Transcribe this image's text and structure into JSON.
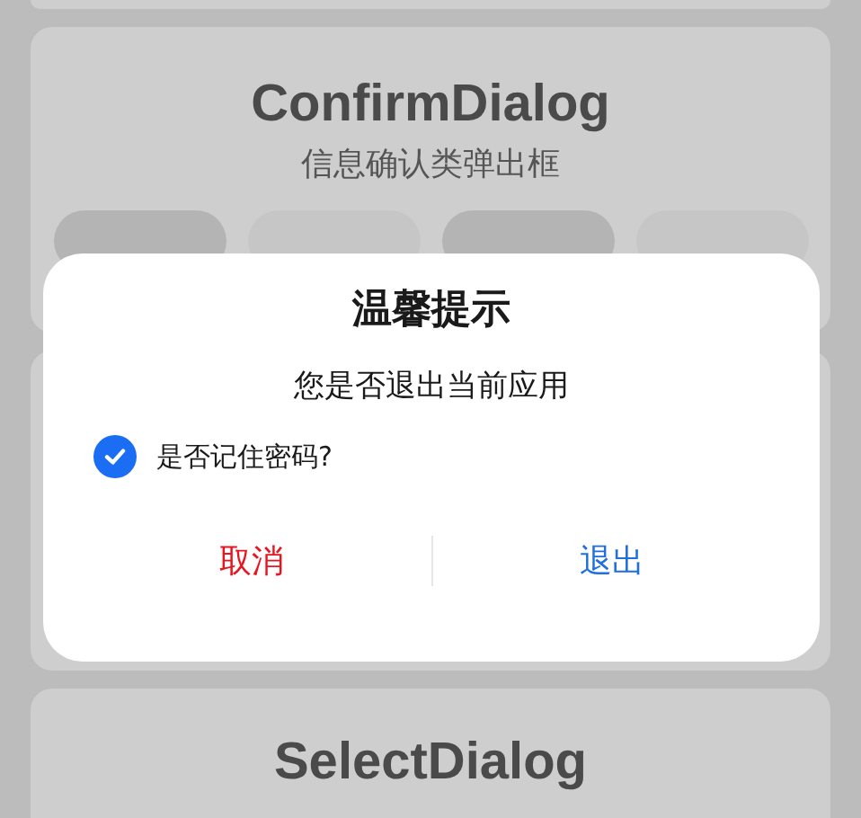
{
  "page": {
    "cards": [
      {
        "title": "ConfirmDialog",
        "subtitle": "信息确认类弹出框"
      },
      {
        "title": "SelectDialog"
      }
    ]
  },
  "dialog": {
    "title": "温馨提示",
    "message": "您是否退出当前应用",
    "checkbox": {
      "label": "是否记住密码?",
      "checked": true
    },
    "buttons": [
      {
        "label": "取消",
        "kind": "cancel"
      },
      {
        "label": "退出",
        "kind": "confirm"
      }
    ]
  }
}
